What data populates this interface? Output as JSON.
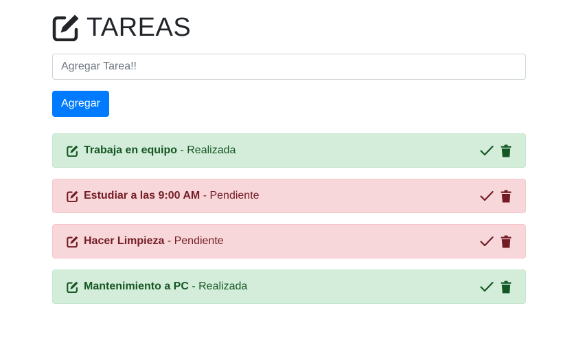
{
  "header": {
    "title": "TAREAS",
    "icon": "edit-icon"
  },
  "form": {
    "placeholder": "Agregar Tarea!!",
    "button_label": "Agregar"
  },
  "tasks": [
    {
      "name": "Trabaja en equipo",
      "separator": " - ",
      "status": "Realizada",
      "state": "done"
    },
    {
      "name": "Estudiar a las 9:00 AM",
      "separator": " - ",
      "status": "Pendiente",
      "state": "pending"
    },
    {
      "name": "Hacer Limpieza",
      "separator": " - ",
      "status": "Pendiente",
      "state": "pending"
    },
    {
      "name": "Mantenimiento a PC",
      "separator": " - ",
      "status": "Realizada",
      "state": "done"
    }
  ],
  "colors": {
    "primary": "#007bff",
    "success_bg": "#d4edda",
    "success_text": "#155724",
    "danger_bg": "#f8d7da",
    "danger_text": "#721c24"
  }
}
